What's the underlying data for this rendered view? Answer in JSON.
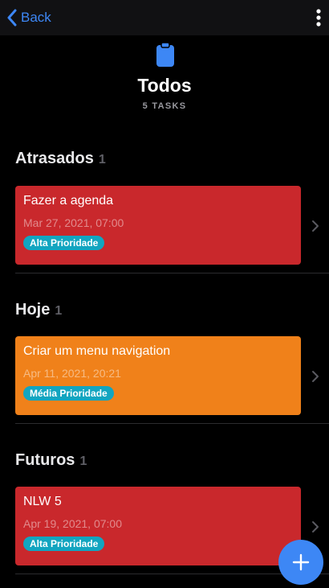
{
  "nav": {
    "back_label": "Back",
    "back_icon": "chevron-left-icon",
    "more_icon": "more-vertical-icon"
  },
  "header": {
    "icon": "clipboard-icon",
    "title": "Todos",
    "subtitle": "5 TASKS"
  },
  "sections": [
    {
      "title": "Atrasados",
      "count": "1",
      "tasks": [
        {
          "title": "Fazer a agenda",
          "date": "Mar 27, 2021, 07:00",
          "priority": "Alta Prioridade",
          "color": "#c9282c"
        }
      ]
    },
    {
      "title": "Hoje",
      "count": "1",
      "tasks": [
        {
          "title": "Criar um menu navigation",
          "date": "Apr 11, 2021, 20:21",
          "priority": "Média Prioridade",
          "color": "#f0811a"
        }
      ]
    },
    {
      "title": "Futuros",
      "count": "1",
      "tasks": [
        {
          "title": "NLW 5",
          "date": "Apr 19, 2021, 07:00",
          "priority": "Alta Prioridade",
          "color": "#c9282c"
        }
      ]
    }
  ],
  "fab": {
    "icon": "plus-icon"
  },
  "colors": {
    "accent": "#3d87f5",
    "badge": "#12a5c0",
    "high_priority": "#c9282c",
    "medium_priority": "#f0811a"
  }
}
